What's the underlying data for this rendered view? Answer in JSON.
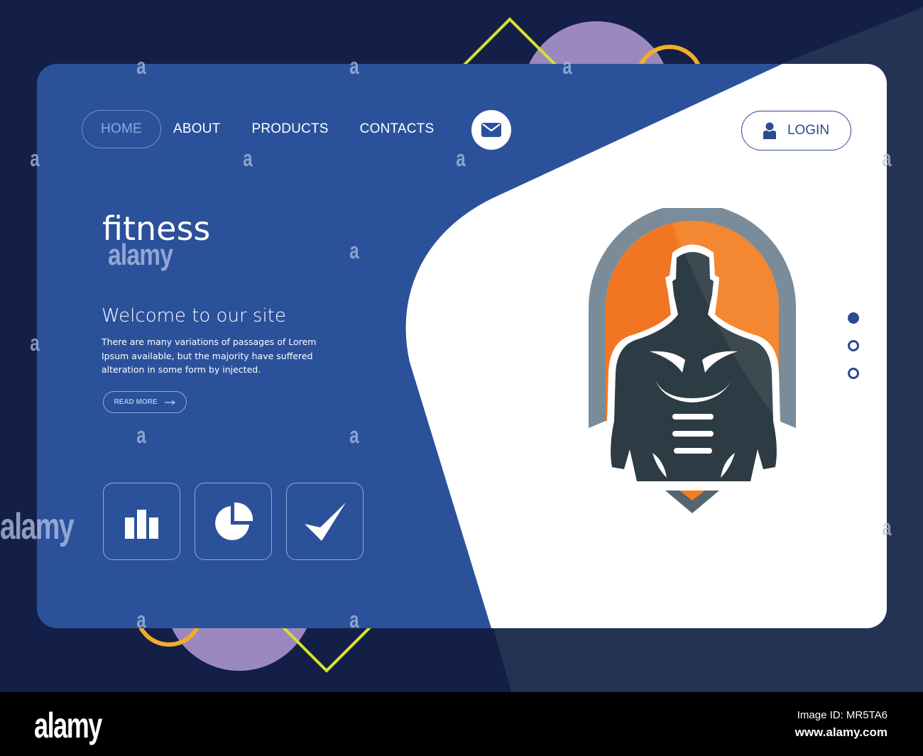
{
  "nav": {
    "items": [
      {
        "label": "HOME",
        "active": true
      },
      {
        "label": "ABOUT",
        "active": false
      },
      {
        "label": "PRODUCTS",
        "active": false
      },
      {
        "label": "CONTACTS",
        "active": false
      }
    ],
    "mail_icon": "envelope-icon",
    "login_label": "LOGIN",
    "login_icon": "user-icon"
  },
  "hero": {
    "title": "fitness",
    "subtitle": "Welcome to our site",
    "body": "There are many variations of passages of Lorem Ipsum available, but the majority have suffered alteration in some form by injected.",
    "read_more_label": "READ MORE",
    "read_more_icon": "arrow-right-icon"
  },
  "features": [
    {
      "icon": "bar-chart-icon"
    },
    {
      "icon": "pie-chart-icon"
    },
    {
      "icon": "checkmark-icon"
    }
  ],
  "slider": {
    "count": 3,
    "active_index": 0
  },
  "logo": {
    "subject": "muscular-man-silhouette",
    "colors": {
      "shield": "#7a8c99",
      "fill": "#f47d20",
      "figure": "#2d3b44"
    }
  },
  "colors": {
    "primary": "#2b519b",
    "dark_bg": "#141f47",
    "accent_purple": "#9b88bf",
    "accent_orange": "#f4ac2a",
    "accent_yellow": "#d8e22a",
    "login_blue": "#2b4a94"
  },
  "watermark": {
    "brand": "alamy",
    "glyph": "a",
    "image_id": "Image ID: MR5TA6",
    "url": "www.alamy.com"
  }
}
